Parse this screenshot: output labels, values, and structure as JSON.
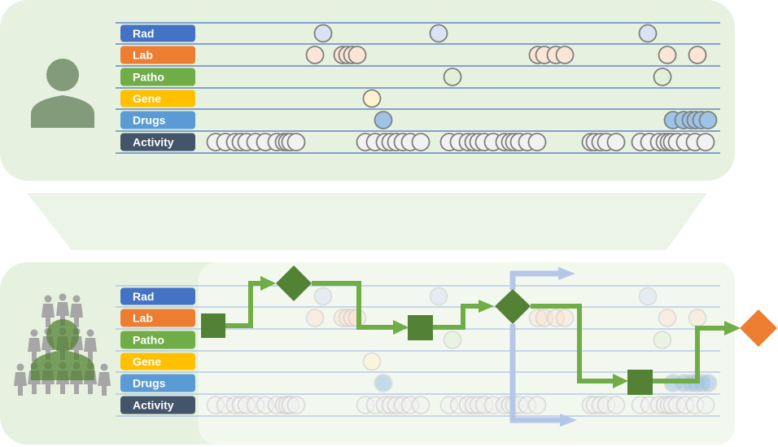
{
  "colors": {
    "panel_bg": "#e6f2df",
    "panel_overlay": "#f3f8ef",
    "funnel": "#ecf3e7",
    "grid_line": "#4472c4",
    "grid_line_faded": "#aac0e6",
    "person_icon": "#839a7b",
    "crowd_icon": "#a6a6a6",
    "flow_green": "#70ad47",
    "flow_node": "#548235",
    "flow_alt": "#b4c7e7",
    "outcome": "#ed7d31"
  },
  "rows": [
    {
      "key": "rad",
      "label": "Rad",
      "color": "#4472c4",
      "event_fill": "#dae3f3"
    },
    {
      "key": "lab",
      "label": "Lab",
      "color": "#ed7d31",
      "event_fill": "#fbe5d6"
    },
    {
      "key": "patho",
      "label": "Patho",
      "color": "#70ad47",
      "event_fill": "#e2f0d9"
    },
    {
      "key": "gene",
      "label": "Gene",
      "color": "#ffc000",
      "event_fill": "#fff2cc"
    },
    {
      "key": "drugs",
      "label": "Drugs",
      "color": "#5b9bd5",
      "event_fill": "#9dc3e6"
    },
    {
      "key": "activity",
      "label": "Activity",
      "color": "#44546a",
      "event_fill": "#f2f2f2"
    }
  ],
  "events": {
    "rad": [
      397,
      539,
      796
    ],
    "lab": [
      387,
      421,
      427,
      433,
      439,
      661,
      669,
      683,
      694,
      820,
      857
    ],
    "patho": [
      556,
      814
    ],
    "gene": [
      457
    ],
    "drugs": [
      471,
      827,
      840,
      849,
      855,
      862,
      870
    ],
    "activity": [
      265,
      277,
      289,
      296,
      303,
      314,
      326,
      340,
      349,
      353,
      357,
      364,
      449,
      461,
      473,
      480,
      487,
      495,
      504,
      517,
      552,
      564,
      575,
      582,
      588,
      595,
      606,
      620,
      627,
      632,
      638,
      648,
      660,
      726,
      731,
      738,
      745,
      757,
      787,
      798,
      810,
      817,
      822,
      826,
      832,
      842,
      854,
      867
    ]
  },
  "top_panel": {
    "subject": "single-patient"
  },
  "bottom_panel": {
    "subject": "patient-cohort"
  },
  "flow": {
    "nodes": [
      {
        "type": "step",
        "label": "step-1"
      },
      {
        "type": "decision",
        "label": "decision-1"
      },
      {
        "type": "step",
        "label": "step-2"
      },
      {
        "type": "decision",
        "label": "decision-2"
      },
      {
        "type": "step",
        "label": "step-3"
      },
      {
        "type": "outcome",
        "label": "outcome"
      }
    ]
  }
}
